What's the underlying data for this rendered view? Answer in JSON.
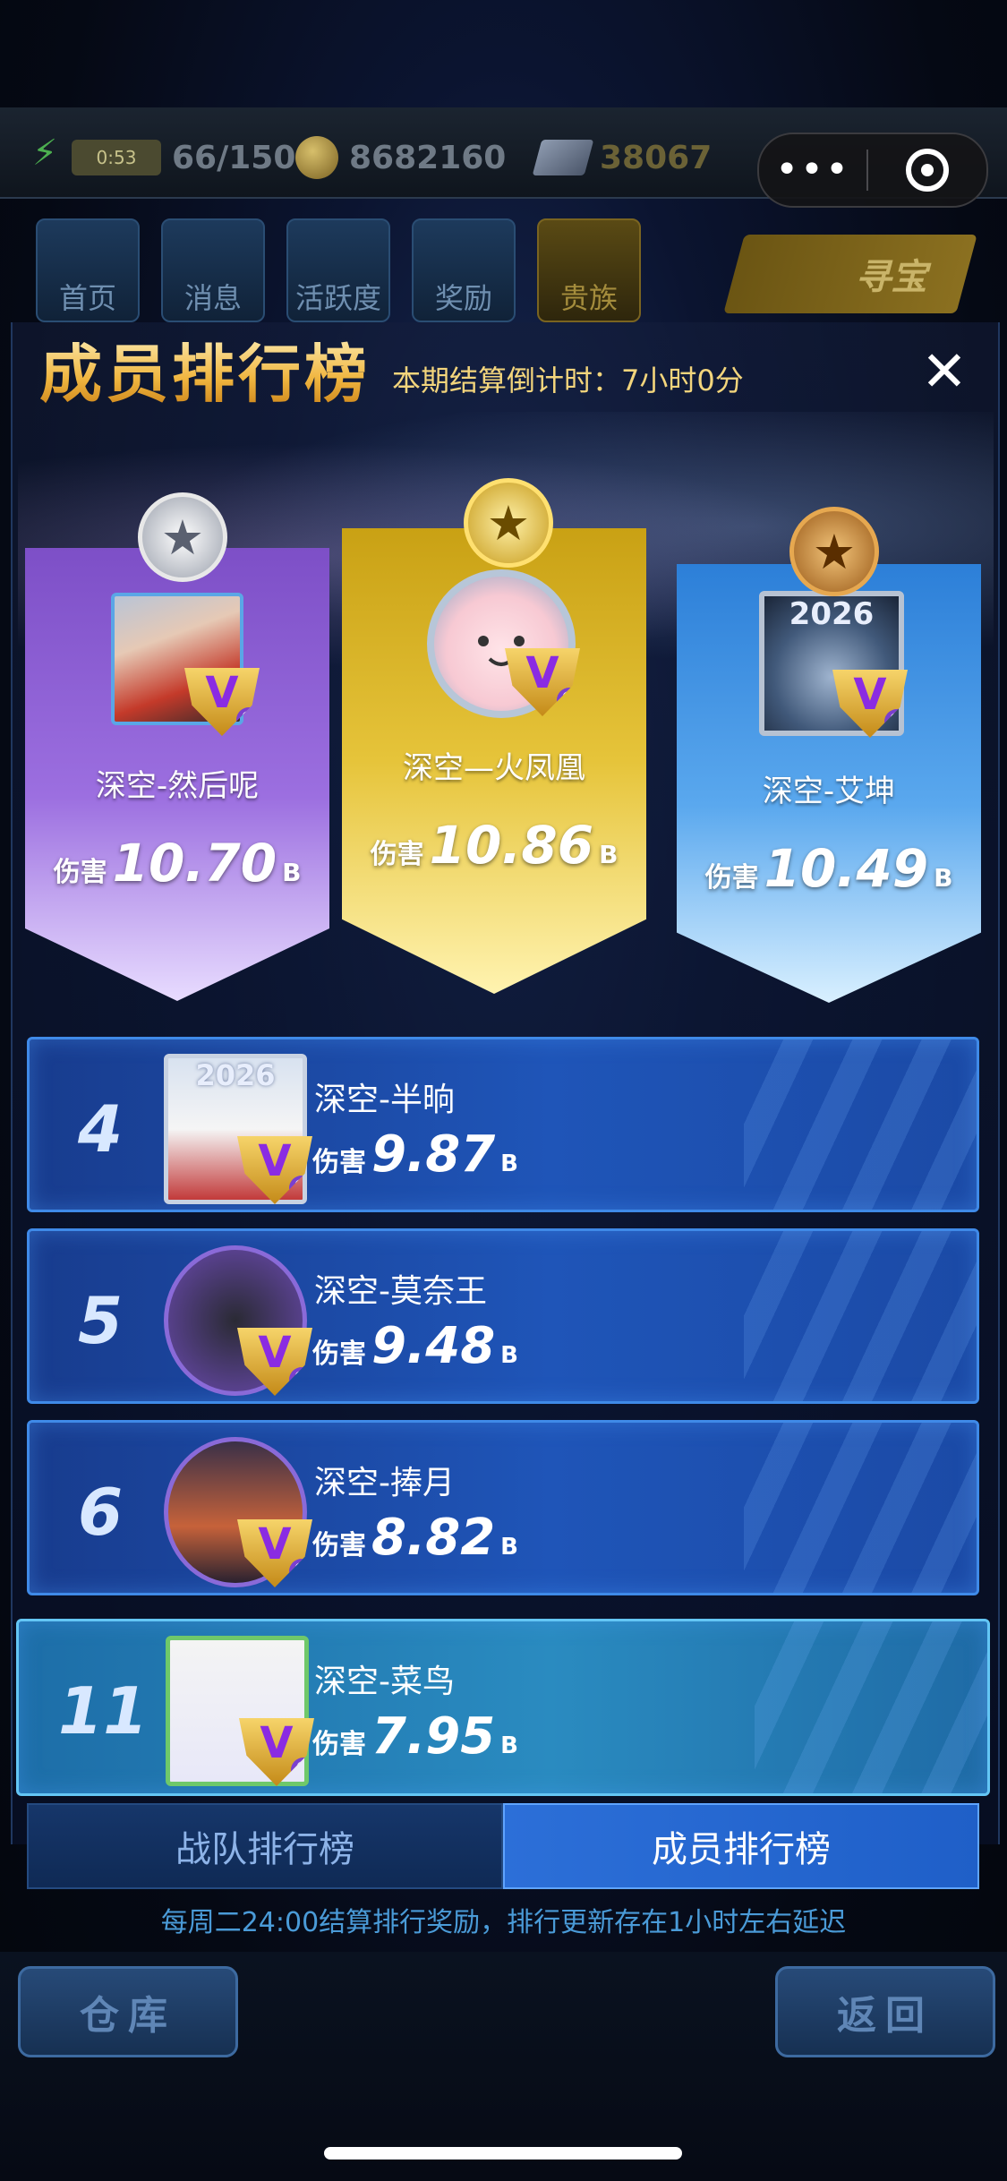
{
  "top_bar": {
    "energy_timer": "0:53",
    "energy": "66/150",
    "coins": "8682160",
    "gems": "38067"
  },
  "capsule": {
    "more": "•••"
  },
  "nav_tabs": [
    {
      "label": "首页"
    },
    {
      "label": "消息"
    },
    {
      "label": "活跃度"
    },
    {
      "label": "奖励"
    },
    {
      "label": "贵族"
    }
  ],
  "treasure_label": "寻宝",
  "panel": {
    "title": "成员排行榜",
    "countdown": "本期结算倒计时：7小时0分"
  },
  "podium": [
    {
      "rank": 2,
      "name": "深空-然后呢",
      "damage_label": "伤害",
      "damage": "10.70",
      "unit": "B",
      "vip_level": "9"
    },
    {
      "rank": 1,
      "name": "深空—火凤凰",
      "damage_label": "伤害",
      "damage": "10.86",
      "unit": "B",
      "vip_level": "9"
    },
    {
      "rank": 3,
      "name": "深空-艾坤",
      "damage_label": "伤害",
      "damage": "10.49",
      "unit": "B",
      "vip_level": "9",
      "frame_year": "2026"
    }
  ],
  "rows": [
    {
      "rank": "4",
      "name": "深空-半晌",
      "damage_label": "伤害",
      "damage": "9.87",
      "unit": "B",
      "vip_level": "9",
      "frame_year": "2026"
    },
    {
      "rank": "5",
      "name": "深空-莫奈王",
      "damage_label": "伤害",
      "damage": "9.48",
      "unit": "B",
      "vip_level": "9"
    },
    {
      "rank": "6",
      "name": "深空-捧月",
      "damage_label": "伤害",
      "damage": "8.82",
      "unit": "B",
      "vip_level": "9"
    },
    {
      "rank": "11",
      "name": "深空-菜鸟",
      "damage_label": "伤害",
      "damage": "7.95",
      "unit": "B",
      "vip_level": "9"
    }
  ],
  "tabs": {
    "team": "战队排行榜",
    "member": "成员排行榜"
  },
  "footnote": "每周二24:00结算排行奖励，排行更新存在1小时左右延迟",
  "bottom": {
    "warehouse": "仓库",
    "back": "返回"
  },
  "colors": {
    "gold": "#e6c43a",
    "silver_purple": "#9c6fe0",
    "bronze_blue": "#5aa8ee",
    "row_blue": "#1f55b8",
    "highlight_row": "#2a8bc0"
  }
}
